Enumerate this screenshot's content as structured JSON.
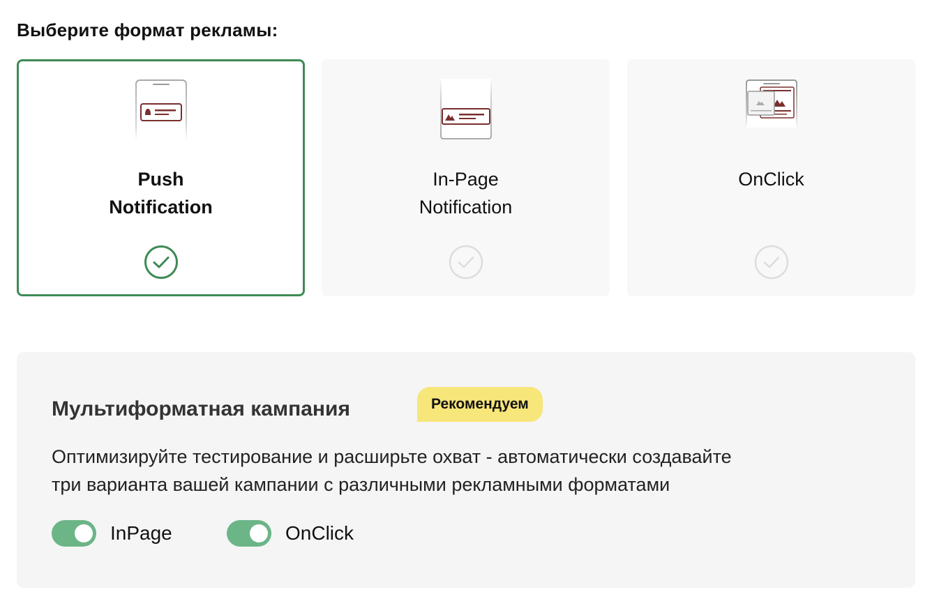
{
  "heading": "Выберите формат рекламы:",
  "formats": [
    {
      "id": "push",
      "title_line1": "Push",
      "title_line2": "Notification",
      "icon": "push-notification-phone-icon",
      "selected": true
    },
    {
      "id": "inpage",
      "title_line1": "In-Page",
      "title_line2": "Notification",
      "icon": "in-page-notification-phone-icon",
      "selected": false
    },
    {
      "id": "onclick",
      "title_line1": "OnClick",
      "title_line2": "",
      "icon": "onclick-windows-icon",
      "selected": false
    }
  ],
  "multiformat": {
    "title": "Мультиформатная кампания",
    "badge": "Рекомендуем",
    "description_line1": "Оптимизируйте тестирование и расширьте охват - автоматически создавайте",
    "description_line2": "три варианта вашей кампании с различными рекламными форматами",
    "toggles": [
      {
        "label": "InPage",
        "on": true
      },
      {
        "label": "OnClick",
        "on": true
      }
    ]
  },
  "colors": {
    "selected_border": "#3d8b55",
    "toggle_on": "#6bb587",
    "badge_bg": "#f7e67a",
    "icon_accent": "#7a2e2e",
    "check_inactive": "#dddddd"
  }
}
